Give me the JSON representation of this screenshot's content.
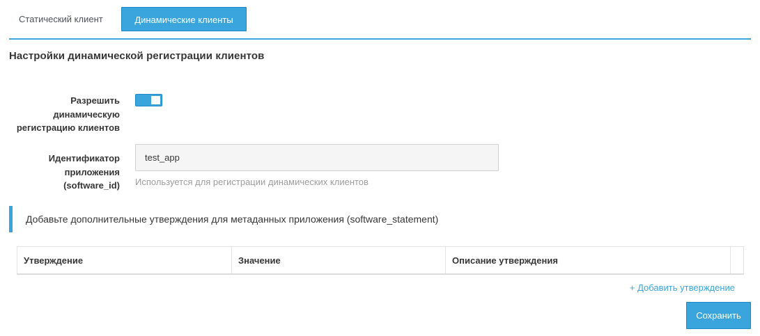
{
  "tabs": {
    "static_label": "Статический клиент",
    "dynamic_label": "Динамические клиенты"
  },
  "section": {
    "title": "Настройки динамической регистрации клиентов"
  },
  "form": {
    "allow_label_line1": "Разрешить",
    "allow_label_line2": "динамическую",
    "allow_label_line3": "регистрацию клиентов",
    "allow_enabled": true,
    "software_label_line1": "Идентификатор",
    "software_label_line2": "приложения",
    "software_label_line3": "(software_id)",
    "software_value": "test_app",
    "software_help": "Используется для регистрации динамических клиентов"
  },
  "statements": {
    "info_text": "Добавьте дополнительные утверждения для метаданных приложения (software_statement)",
    "columns": [
      "Утверждение",
      "Значение",
      "Описание утверждения"
    ],
    "add_label": "+ Добавить утверждение"
  },
  "actions": {
    "save_label": "Сохранить"
  },
  "colors": {
    "accent": "#39a5dc",
    "accent_border": "#1d87c7"
  }
}
